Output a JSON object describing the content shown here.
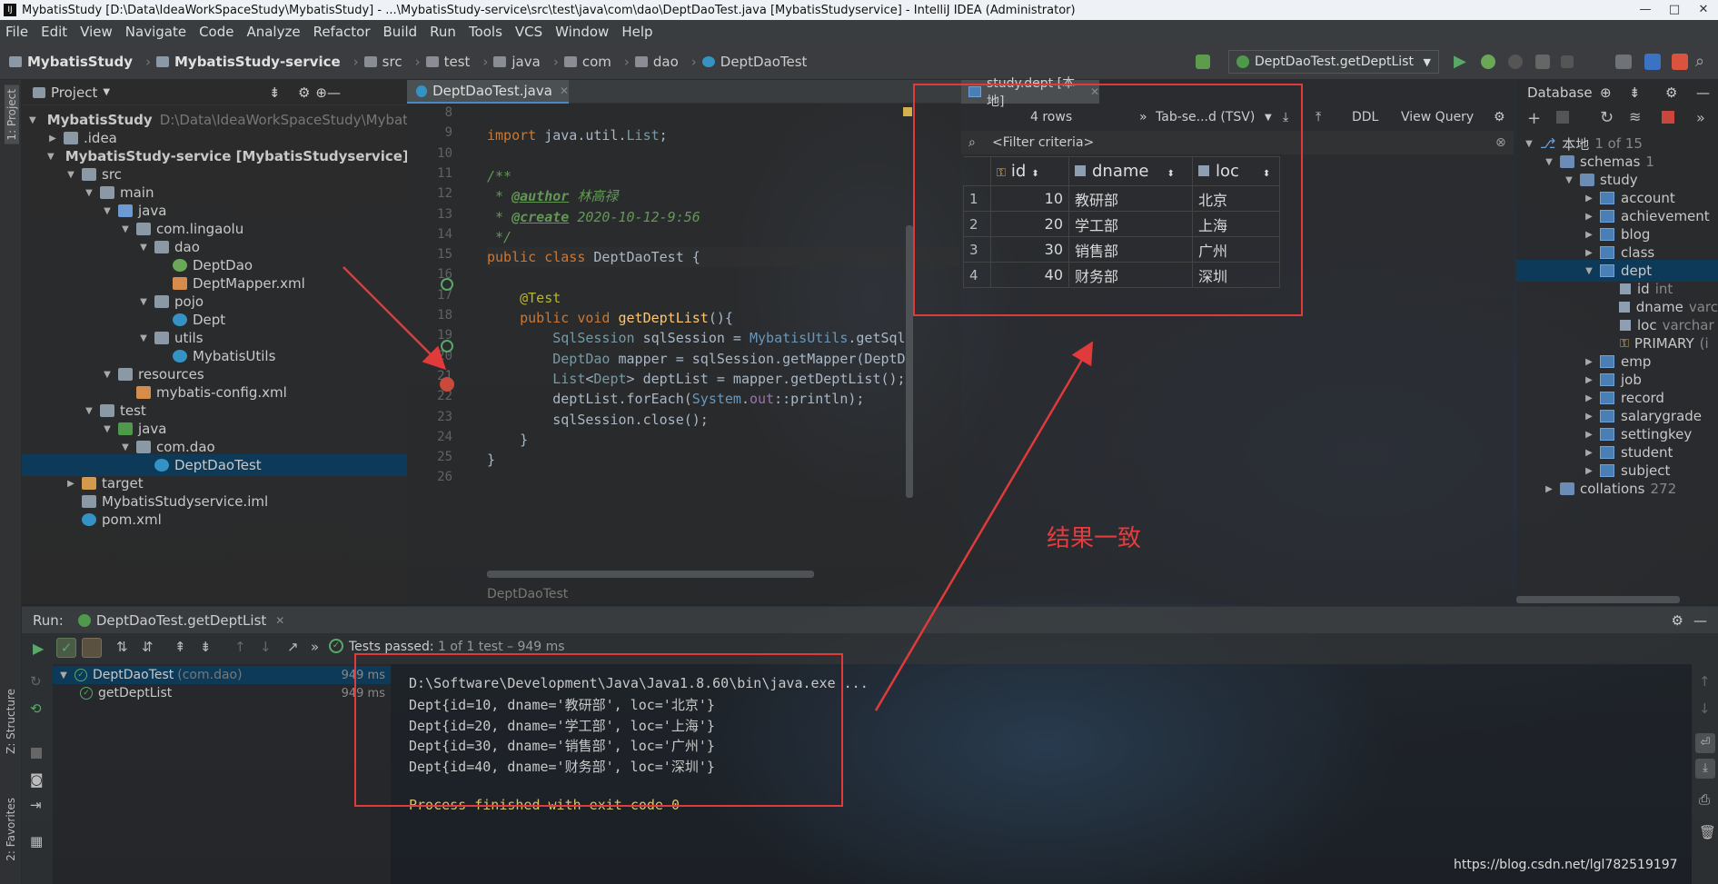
{
  "title": "MybatisStudy [D:\\Data\\IdeaWorkSpaceStudy\\MybatisStudy] - ...\\MybatisStudy-service\\src\\test\\java\\com\\dao\\DeptDaoTest.java [MybatisStudyservice] - IntelliJ IDEA (Administrator)",
  "menu": [
    "File",
    "Edit",
    "View",
    "Navigate",
    "Code",
    "Analyze",
    "Refactor",
    "Build",
    "Run",
    "Tools",
    "VCS",
    "Window",
    "Help"
  ],
  "breadcrumbs": [
    "MybatisStudy",
    "MybatisStudy-service",
    "src",
    "test",
    "java",
    "com",
    "dao",
    "DeptDaoTest"
  ],
  "run_config": "DeptDaoTest.getDeptList",
  "project": {
    "header": "Project",
    "strip_label": "1: Project",
    "tree": [
      {
        "label": "MybatisStudy",
        "extra": "D:\\Data\\IdeaWorkSpaceStudy\\MybatisSt",
        "indent": 0,
        "icon": "folder",
        "expanded": true
      },
      {
        "label": ".idea",
        "indent": 1,
        "icon": "folder",
        "expanded": false
      },
      {
        "label": "MybatisStudy-service [MybatisStudyservice]",
        "indent": 1,
        "icon": "folder",
        "expanded": true
      },
      {
        "label": "src",
        "indent": 2,
        "icon": "folder",
        "expanded": true
      },
      {
        "label": "main",
        "indent": 3,
        "icon": "folder",
        "expanded": true
      },
      {
        "label": "java",
        "indent": 4,
        "icon": "src",
        "expanded": true
      },
      {
        "label": "com.lingaolu",
        "indent": 5,
        "icon": "folder",
        "expanded": true
      },
      {
        "label": "dao",
        "indent": 6,
        "icon": "folder",
        "expanded": true
      },
      {
        "label": "DeptDao",
        "indent": 7,
        "icon": "int"
      },
      {
        "label": "DeptMapper.xml",
        "indent": 7,
        "icon": "xml"
      },
      {
        "label": "pojo",
        "indent": 6,
        "icon": "folder",
        "expanded": true
      },
      {
        "label": "Dept",
        "indent": 7,
        "icon": "cls"
      },
      {
        "label": "utils",
        "indent": 6,
        "icon": "folder",
        "expanded": true
      },
      {
        "label": "MybatisUtils",
        "indent": 7,
        "icon": "cls"
      },
      {
        "label": "resources",
        "indent": 4,
        "icon": "folder",
        "expanded": true
      },
      {
        "label": "mybatis-config.xml",
        "indent": 5,
        "icon": "xml"
      },
      {
        "label": "test",
        "indent": 3,
        "icon": "folder",
        "expanded": true
      },
      {
        "label": "java",
        "indent": 4,
        "icon": "test",
        "expanded": true
      },
      {
        "label": "com.dao",
        "indent": 5,
        "icon": "folder",
        "expanded": true
      },
      {
        "label": "DeptDaoTest",
        "indent": 6,
        "icon": "cls",
        "selected": true
      },
      {
        "label": "target",
        "indent": 2,
        "icon": "orange",
        "expanded": false
      },
      {
        "label": "MybatisStudyservice.iml",
        "indent": 2,
        "icon": "folder"
      },
      {
        "label": "pom.xml",
        "indent": 2,
        "icon": "cls"
      }
    ]
  },
  "editor": {
    "tab": "DeptDaoTest.java",
    "footer": "DeptDaoTest",
    "lines": [
      {
        "n": "8",
        "t": ""
      },
      {
        "n": "9",
        "t": "import java.util.List;"
      },
      {
        "n": "10",
        "t": ""
      },
      {
        "n": "11",
        "t": "/**"
      },
      {
        "n": "12",
        "t": " * @author 林高禄"
      },
      {
        "n": "13",
        "t": " * @create 2020-10-12-9:56"
      },
      {
        "n": "14",
        "t": " */"
      },
      {
        "n": "15",
        "t": "public class DeptDaoTest {"
      },
      {
        "n": "16",
        "t": ""
      },
      {
        "n": "17",
        "t": "    @Test"
      },
      {
        "n": "18",
        "t": "    public void getDeptList(){"
      },
      {
        "n": "19",
        "t": "        SqlSession sqlSession = MybatisUtils.getSql"
      },
      {
        "n": "20",
        "t": "        DeptDao mapper = sqlSession.getMapper(DeptDa"
      },
      {
        "n": "21",
        "t": "        List<Dept> deptList = mapper.getDeptList();"
      },
      {
        "n": "22",
        "t": "        deptList.forEach(System.out::println);"
      },
      {
        "n": "23",
        "t": "        sqlSession.close();"
      },
      {
        "n": "24",
        "t": "    }"
      },
      {
        "n": "25",
        "t": "}"
      },
      {
        "n": "26",
        "t": ""
      }
    ]
  },
  "dbgrid": {
    "tab": "study.dept [本地]",
    "rows_label": "4 rows",
    "format": "Tab-se...d (TSV)",
    "ddl": "DDL",
    "view_query": "View Query",
    "filter": "<Filter criteria>",
    "columns": [
      "id",
      "dname",
      "loc"
    ],
    "rows": [
      {
        "n": "1",
        "id": "10",
        "dname": "教研部",
        "loc": "北京"
      },
      {
        "n": "2",
        "id": "20",
        "dname": "学工部",
        "loc": "上海"
      },
      {
        "n": "3",
        "id": "30",
        "dname": "销售部",
        "loc": "广州"
      },
      {
        "n": "4",
        "id": "40",
        "dname": "财务部",
        "loc": "深圳"
      }
    ]
  },
  "database": {
    "header": "Database",
    "tree": [
      {
        "label": "本地",
        "extra": "1 of 15",
        "indent": 0,
        "kind": "conn"
      },
      {
        "label": "schemas",
        "extra": "1",
        "indent": 1,
        "kind": "folder"
      },
      {
        "label": "study",
        "indent": 2,
        "kind": "folder"
      },
      {
        "label": "account",
        "indent": 3,
        "kind": "table"
      },
      {
        "label": "achievement",
        "indent": 3,
        "kind": "table"
      },
      {
        "label": "blog",
        "indent": 3,
        "kind": "table"
      },
      {
        "label": "class",
        "indent": 3,
        "kind": "table"
      },
      {
        "label": "dept",
        "indent": 3,
        "kind": "table",
        "selected": true,
        "expanded": true
      },
      {
        "label": "id",
        "extra": "int",
        "indent": 4,
        "kind": "col"
      },
      {
        "label": "dname",
        "extra": "varc",
        "indent": 4,
        "kind": "col"
      },
      {
        "label": "loc",
        "extra": "varchar",
        "indent": 4,
        "kind": "col"
      },
      {
        "label": "PRIMARY",
        "extra": "(i",
        "indent": 4,
        "kind": "key"
      },
      {
        "label": "emp",
        "indent": 3,
        "kind": "table"
      },
      {
        "label": "job",
        "indent": 3,
        "kind": "table"
      },
      {
        "label": "record",
        "indent": 3,
        "kind": "table"
      },
      {
        "label": "salarygrade",
        "indent": 3,
        "kind": "table"
      },
      {
        "label": "settingkey",
        "indent": 3,
        "kind": "table"
      },
      {
        "label": "student",
        "indent": 3,
        "kind": "table"
      },
      {
        "label": "subject",
        "indent": 3,
        "kind": "table"
      },
      {
        "label": "collations",
        "extra": "272",
        "indent": 1,
        "kind": "folder"
      }
    ]
  },
  "run": {
    "label": "Run:",
    "tab": "DeptDaoTest.getDeptList",
    "status_prefix": "Tests passed:",
    "status_rest": "1 of 1 test – 949 ms",
    "tree": [
      {
        "label": "DeptDaoTest",
        "extra": "(com.dao)",
        "time": "949 ms",
        "indent": 0
      },
      {
        "label": "getDeptList",
        "time": "949 ms",
        "indent": 1
      }
    ],
    "console": [
      "D:\\Software\\Development\\Java\\Java1.8.60\\bin\\java.exe ...",
      "Dept{id=10, dname='教研部', loc='北京'}",
      "Dept{id=20, dname='学工部', loc='上海'}",
      "Dept{id=30, dname='销售部', loc='广州'}",
      "Dept{id=40, dname='财务部', loc='深圳'}",
      "",
      "Process finished with exit code 0"
    ]
  },
  "strips": {
    "structure": "Z: Structure",
    "favorites": "2: Favorites"
  },
  "annotation": "结果一致",
  "watermark": "https://blog.csdn.net/lgl782519197",
  "colors": {
    "accent": "#4a88c7",
    "red_annotation": "#e03a3a",
    "pass_green": "#59a869"
  }
}
